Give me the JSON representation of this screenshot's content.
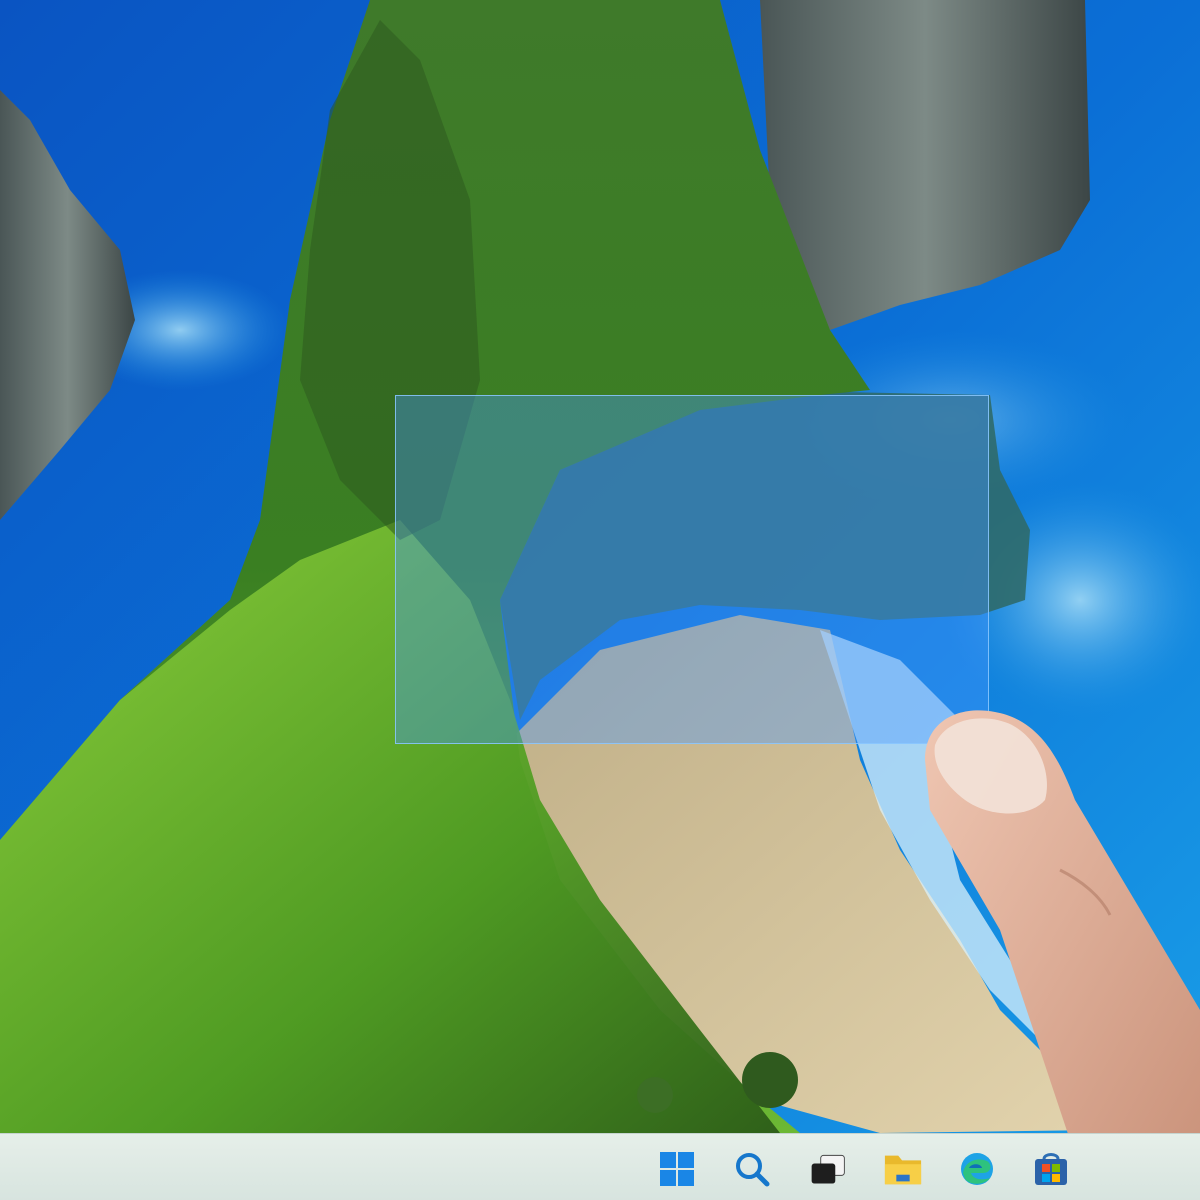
{
  "colors": {
    "sea_deep": "#0a3f9e",
    "sea_light": "#1f8de0",
    "cliff_green": "#5aa52a",
    "cliff_dark": "#2f5e1e",
    "rock": "#5a6a6a",
    "sand": "#cdbb92",
    "selection_fill": "#4696ff",
    "taskbar": "#dfe9e4",
    "accent": "#0a78d4"
  },
  "taskbar": {
    "items": [
      {
        "name": "start-button",
        "icon": "windows-logo-icon"
      },
      {
        "name": "search-button",
        "icon": "search-icon"
      },
      {
        "name": "task-view-button",
        "icon": "task-view-icon"
      },
      {
        "name": "file-explorer-button",
        "icon": "folder-icon"
      },
      {
        "name": "edge-button",
        "icon": "edge-icon"
      },
      {
        "name": "store-button",
        "icon": "store-icon"
      }
    ]
  }
}
